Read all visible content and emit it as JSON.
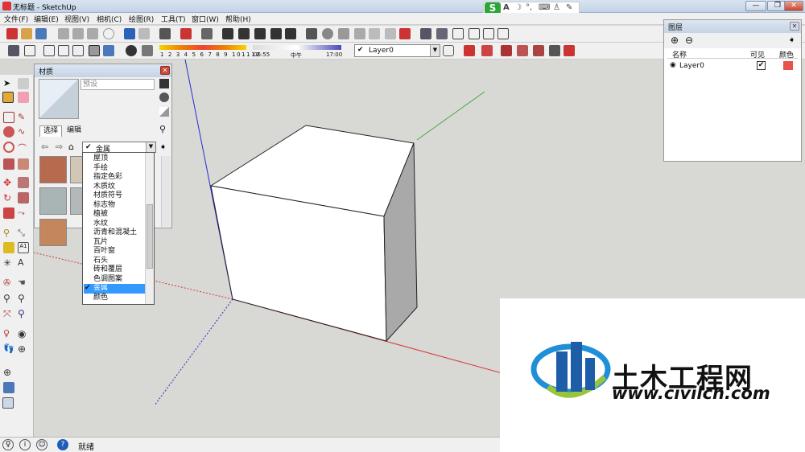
{
  "window": {
    "title": "无标题 - SketchUp"
  },
  "menu": [
    "文件(F)",
    "编辑(E)",
    "视图(V)",
    "相机(C)",
    "绘图(R)",
    "工具(T)",
    "窗口(W)",
    "帮助(H)"
  ],
  "ime": {
    "logo": "S",
    "mode": "A"
  },
  "shadow": {
    "months": [
      "1",
      "2",
      "3",
      "4",
      "5",
      "6",
      "7",
      "8",
      "9",
      "10",
      "11",
      "12"
    ],
    "time_start": "06:55",
    "time_mid": "中午",
    "time_end": "17:00"
  },
  "layer_select": {
    "value": "Layer0"
  },
  "materials": {
    "title": "材质",
    "name_placeholder": "预设",
    "tabs": [
      "选择",
      "编辑"
    ],
    "selected_collection": "金属",
    "collections": [
      "屋顶",
      "手绘",
      "指定色彩",
      "木质纹",
      "材质符号",
      "标志物",
      "植被",
      "水纹",
      "沥青和混凝土",
      "瓦片",
      "百叶窗",
      "石头",
      "砖和覆层",
      "色调图案",
      "金属",
      "颜色"
    ]
  },
  "layers": {
    "title": "图层",
    "columns": [
      "名称",
      "可见",
      "颜色"
    ],
    "rows": [
      {
        "name": "Layer0",
        "visible": true,
        "color": "#e8514a"
      }
    ]
  },
  "status": {
    "text": "就绪"
  },
  "watermark": {
    "title": "土木工程网",
    "url": "www.civilcn.com"
  },
  "colors": {
    "accent": "#3399ff",
    "axis_red": "#d23a3a",
    "axis_green": "#3cb043",
    "axis_blue": "#2a2ad2"
  }
}
